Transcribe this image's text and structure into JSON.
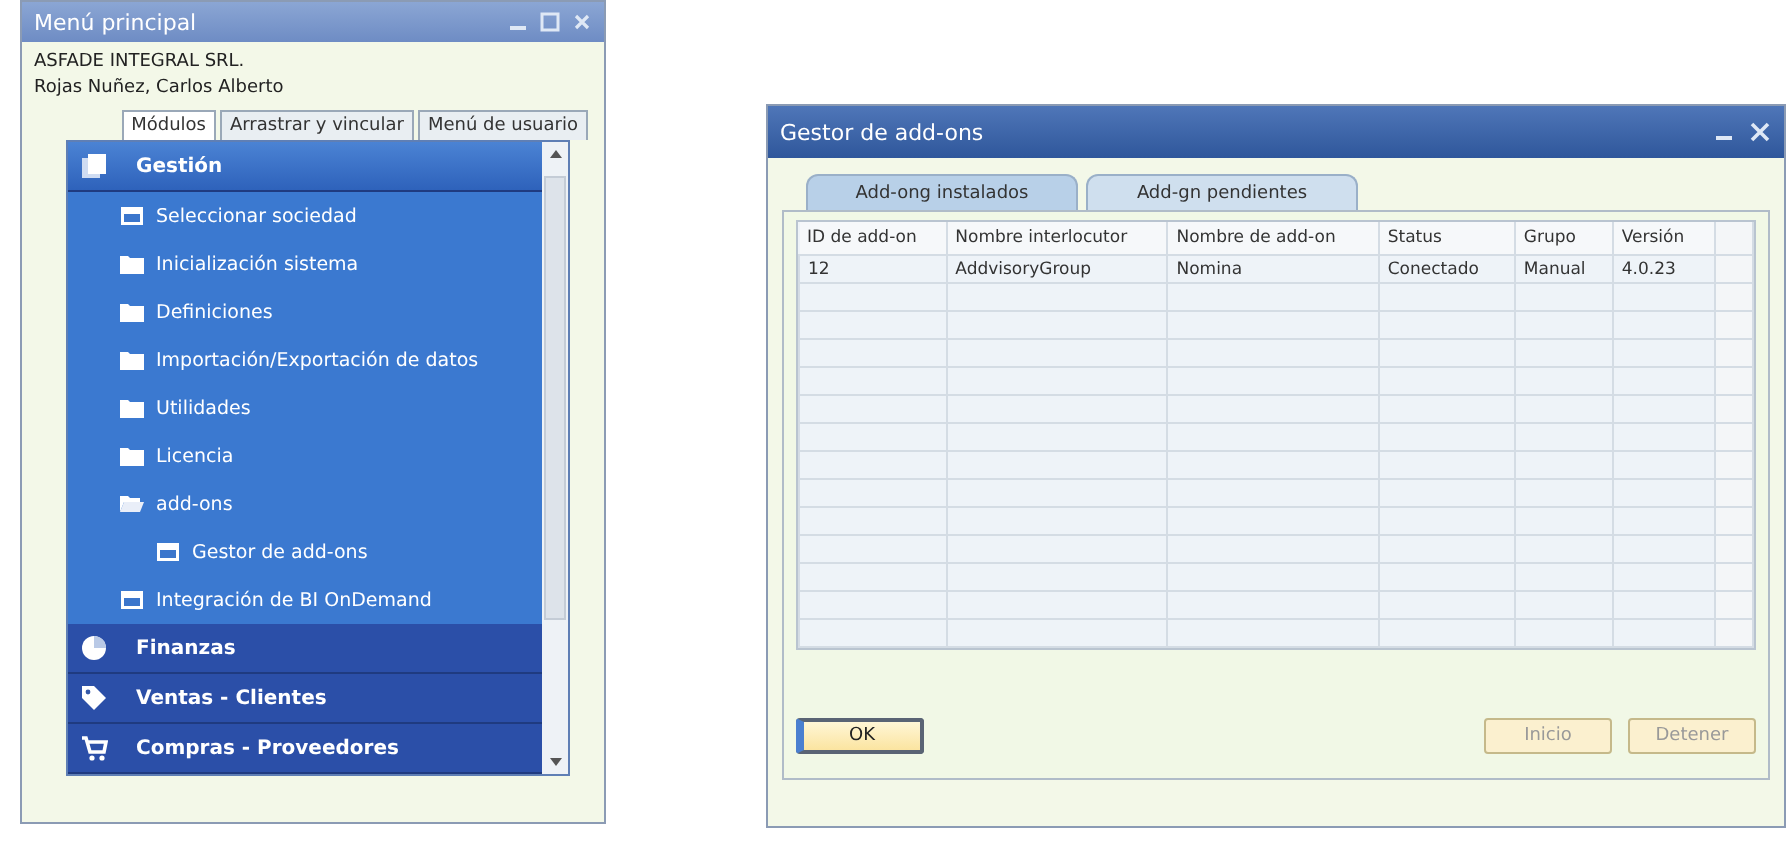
{
  "main_menu": {
    "title": "Menú principal",
    "company": "ASFADE INTEGRAL SRL.",
    "user": "Rojas Nuñez, Carlos Alberto",
    "tabs": [
      {
        "label": "Módulos",
        "selected": true
      },
      {
        "label": "Arrastrar y vincular",
        "selected": false
      },
      {
        "label": "Menú de usuario",
        "selected": false
      }
    ],
    "modules": [
      {
        "label": "Gestión",
        "kind": "pages",
        "expanded": true,
        "children": [
          {
            "label": "Seleccionar sociedad",
            "kind": "form"
          },
          {
            "label": "Inicialización sistema",
            "kind": "folder",
            "expanded": false
          },
          {
            "label": "Definiciones",
            "kind": "folder",
            "expanded": false
          },
          {
            "label": "Importación/Exportación de datos",
            "kind": "folder",
            "expanded": false
          },
          {
            "label": "Utilidades",
            "kind": "folder",
            "expanded": false
          },
          {
            "label": "Licencia",
            "kind": "folder",
            "expanded": false
          },
          {
            "label": "add-ons",
            "kind": "folder",
            "expanded": true,
            "children": [
              {
                "label": "Gestor de add-ons",
                "kind": "form"
              }
            ]
          },
          {
            "label": "Integración de BI OnDemand",
            "kind": "form"
          }
        ]
      },
      {
        "label": "Finanzas",
        "kind": "pie",
        "expanded": false
      },
      {
        "label": "Ventas - Clientes",
        "kind": "tag",
        "expanded": false
      },
      {
        "label": "Compras - Proveedores",
        "kind": "cart",
        "expanded": false
      }
    ]
  },
  "addon_manager": {
    "title": "Gestor de add-ons",
    "tabs": [
      {
        "label": "Add-ong instalados",
        "selected": true
      },
      {
        "label": "Add-gn pendientes",
        "selected": false
      }
    ],
    "table": {
      "columns": [
        "ID de add-on",
        "Nombre interlocutor",
        "Nombre de add-on",
        "Status",
        "Grupo",
        "Versión"
      ],
      "rows": [
        [
          "12",
          "AddvisoryGroup",
          "Nomina",
          "Conectado",
          "Manual",
          "4.0.23"
        ]
      ]
    },
    "buttons": [
      {
        "label": "OK",
        "disabled": false
      },
      {
        "label": "Inicio",
        "disabled": true
      },
      {
        "label": "Detener",
        "disabled": true
      }
    ]
  }
}
